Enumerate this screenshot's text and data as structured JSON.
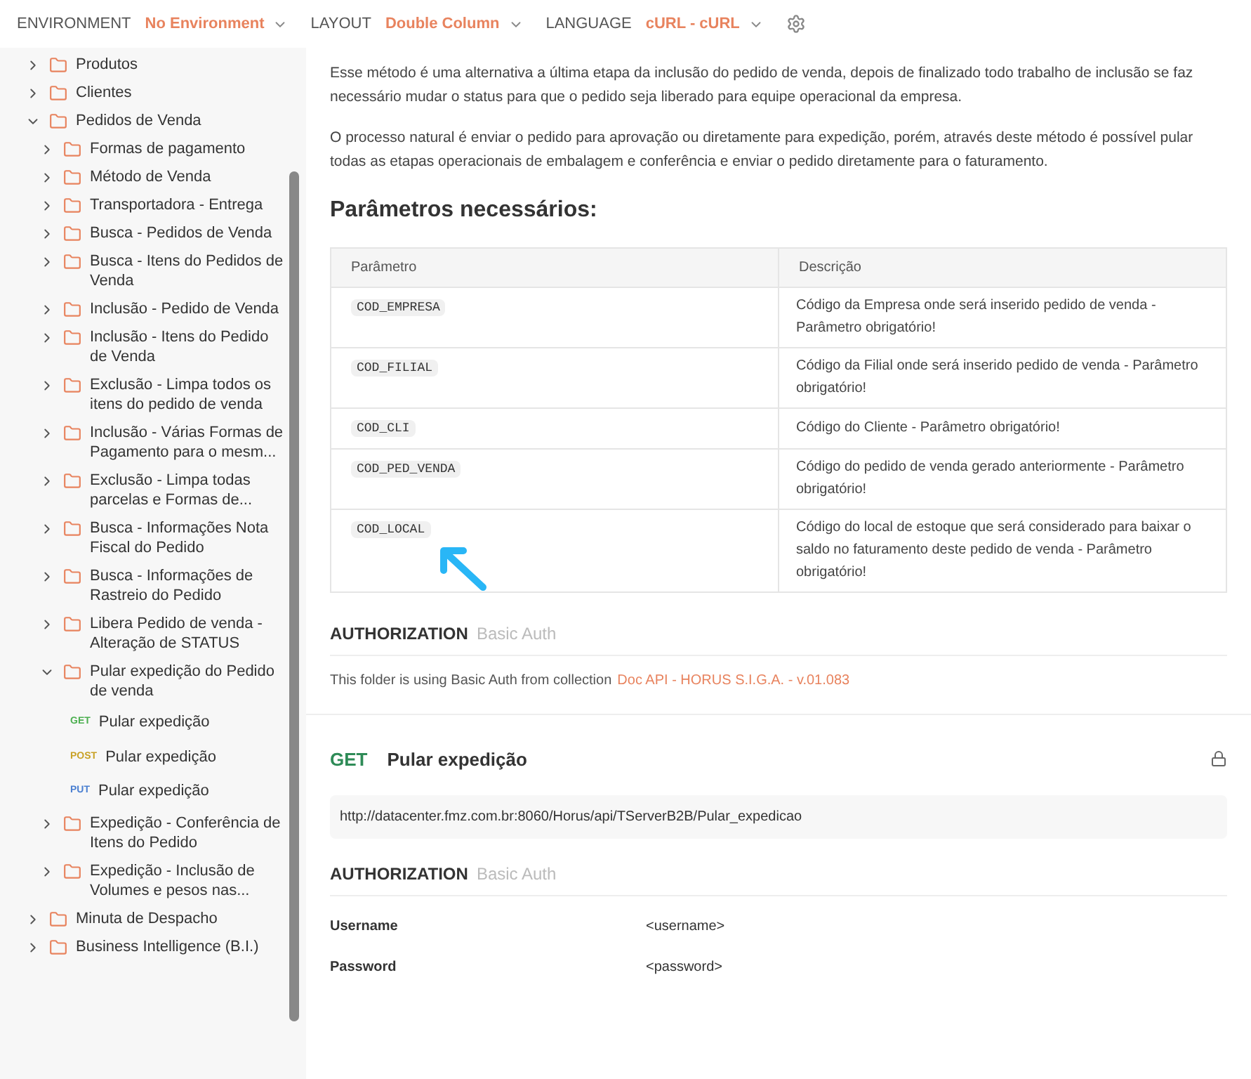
{
  "topbar": [
    {
      "label": "ENVIRONMENT",
      "value": "No Environment"
    },
    {
      "label": "LAYOUT",
      "value": "Double Column"
    },
    {
      "label": "LANGUAGE",
      "value": "cURL - cURL"
    }
  ],
  "sidebar": {
    "items": [
      {
        "kind": "folder",
        "label": "Produtos",
        "expanded": false
      },
      {
        "kind": "folder",
        "label": "Clientes",
        "expanded": false
      },
      {
        "kind": "folder",
        "label": "Pedidos de Venda",
        "expanded": true,
        "children": [
          {
            "kind": "folder",
            "label": "Formas de pagamento",
            "expanded": false
          },
          {
            "kind": "folder",
            "label": "Método de Venda",
            "expanded": false
          },
          {
            "kind": "folder",
            "label": "Transportadora - Entrega",
            "expanded": false
          },
          {
            "kind": "folder",
            "label": "Busca - Pedidos de Venda",
            "expanded": false
          },
          {
            "kind": "folder",
            "label": "Busca - Itens do Pedidos de Venda",
            "expanded": false
          },
          {
            "kind": "folder",
            "label": "Inclusão - Pedido de Venda",
            "expanded": false
          },
          {
            "kind": "folder",
            "label": "Inclusão - Itens do Pedido de Venda",
            "expanded": false
          },
          {
            "kind": "folder",
            "label": "Exclusão - Limpa todos os itens do pedido de venda",
            "expanded": false
          },
          {
            "kind": "folder",
            "label": "Inclusão - Várias Formas de Pagamento para o mesm...",
            "expanded": false
          },
          {
            "kind": "folder",
            "label": "Exclusão - Limpa todas parcelas e Formas de...",
            "expanded": false
          },
          {
            "kind": "folder",
            "label": "Busca - Informações Nota Fiscal do Pedido",
            "expanded": false
          },
          {
            "kind": "folder",
            "label": "Busca - Informações de Rastreio do Pedido",
            "expanded": false
          },
          {
            "kind": "folder",
            "label": "Libera Pedido de venda - Alteração de STATUS",
            "expanded": false
          },
          {
            "kind": "folder",
            "label": "Pular expedição do Pedido de venda",
            "expanded": true,
            "children": [
              {
                "kind": "request",
                "method": "GET",
                "color": "#4caf50",
                "label": "Pular expedição"
              },
              {
                "kind": "request",
                "method": "POST",
                "color": "#c9a227",
                "label": "Pular expedição"
              },
              {
                "kind": "request",
                "method": "PUT",
                "color": "#4a7fd1",
                "label": "Pular expedição"
              }
            ]
          },
          {
            "kind": "folder",
            "label": "Expedição - Conferência de Itens do Pedido",
            "expanded": false
          },
          {
            "kind": "folder",
            "label": "Expedição - Inclusão de Volumes e pesos nas...",
            "expanded": false
          }
        ]
      },
      {
        "kind": "folder",
        "label": "Minuta de Despacho",
        "expanded": false
      },
      {
        "kind": "folder",
        "label": "Business Intelligence (B.I.)",
        "expanded": false
      }
    ]
  },
  "content": {
    "paragraphs": [
      "Esse método é uma alternativa a última etapa da inclusão do pedido de venda, depois de finalizado todo trabalho de inclusão se faz necessário mudar o status para que o pedido seja liberado para equipe operacional da empresa.",
      "O processo natural é enviar o pedido para aprovação ou diretamente para expedição, porém, através deste método é possível pular todas as etapas operacionais de embalagem e conferência e enviar o pedido diretamente para o faturamento."
    ],
    "heading": "Parâmetros necessários:",
    "table": {
      "columns": [
        "Parâmetro",
        "Descrição"
      ],
      "rows": [
        [
          "COD_EMPRESA",
          "Código da Empresa onde será inserido pedido de venda - Parâmetro obrigatório!"
        ],
        [
          "COD_FILIAL",
          "Código da Filial onde será inserido pedido de venda - Parâmetro obrigatório!"
        ],
        [
          "COD_CLI",
          "Código do Cliente - Parâmetro obrigatório!"
        ],
        [
          "COD_PED_VENDA",
          "Código do pedido de venda gerado anteriormente - Parâmetro obrigatório!"
        ],
        [
          "COD_LOCAL",
          "Código do local de estoque que será considerado para baixar o saldo no faturamento deste pedido de venda - Parâmetro obrigatório!"
        ]
      ]
    },
    "folder_auth": {
      "title": "AUTHORIZATION",
      "type": "Basic Auth",
      "note": "This folder is using Basic Auth from collection",
      "link": "Doc API - HORUS S.I.G.A. - v.01.083"
    },
    "request": {
      "method": "GET",
      "name": "Pular expedição",
      "url": "http://datacenter.fmz.com.br:8060/Horus/api/TServerB2B/Pular_expedicao",
      "auth": {
        "title": "AUTHORIZATION",
        "type": "Basic Auth",
        "fields": [
          {
            "key": "Username",
            "value": "<username>"
          },
          {
            "key": "Password",
            "value": "<password>"
          }
        ]
      }
    }
  }
}
